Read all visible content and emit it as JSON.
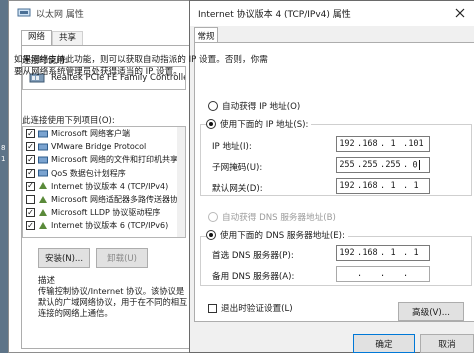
{
  "background_window": {
    "title": "以太网 属性",
    "tabs": [
      "网络",
      "共享"
    ],
    "connect_using_label": "连接时使用:",
    "adapter_name": "Realtek PCIe FE Family Controller",
    "components_label": "此连接使用下列项目(O):",
    "components": [
      {
        "label": "Microsoft 网络客户端",
        "checked": true
      },
      {
        "label": "VMware Bridge Protocol",
        "checked": true
      },
      {
        "label": "Microsoft 网络的文件和打印机共享",
        "checked": true
      },
      {
        "label": "QoS 数据包计划程序",
        "checked": true
      },
      {
        "label": "Internet 协议版本 4 (TCP/IPv4)",
        "checked": true
      },
      {
        "label": "Microsoft 网络适配器多路传送器协议",
        "checked": false
      },
      {
        "label": "Microsoft LLDP 协议驱动程序",
        "checked": true
      },
      {
        "label": "Internet 协议版本 6 (TCP/IPv6)",
        "checked": true
      }
    ],
    "install_button": "安装(N)...",
    "uninstall_button": "卸载(U)",
    "description_title": "描述",
    "description_text": "传输控制协议/Internet 协议。该协议是默认的广域网络协议，用于在不同的相互连接的网络上通信。",
    "left_strip_text": [
      "8",
      "1"
    ]
  },
  "dialog": {
    "title": "Internet 协议版本 4 (TCP/IPv4) 属性",
    "tab_general": "常规",
    "intro_text": "如果网络支持此功能，则可以获取自动指派的 IP 设置。否则，你需要从网络系统管理员处获得适当的 IP 设置。",
    "auto_ip_label": "自动获得 IP 地址(O)",
    "manual_ip_label": "使用下面的 IP 地址(S):",
    "ip_label": "IP 地址(I):",
    "subnet_label": "子网掩码(U):",
    "gateway_label": "默认网关(D):",
    "ip_octets": [
      "192",
      "168",
      "1",
      "101"
    ],
    "subnet_octets": [
      "255",
      "255",
      "255",
      "0"
    ],
    "gateway_octets": [
      "192",
      "168",
      "1",
      "1"
    ],
    "auto_dns_label": "自动获得 DNS 服务器地址(B)",
    "manual_dns_label": "使用下面的 DNS 服务器地址(E):",
    "preferred_dns_label": "首选 DNS 服务器(P):",
    "alternate_dns_label": "备用 DNS 服务器(A):",
    "preferred_dns_octets": [
      "192",
      "168",
      "1",
      "1"
    ],
    "alternate_dns_octets": [
      "",
      "",
      "",
      ""
    ],
    "validate_label": "退出时验证设置(L)",
    "advanced_button": "高级(V)...",
    "ok_button": "确定",
    "cancel_button": "取消"
  },
  "icons": {
    "title_icon": "network-adapter-icon",
    "close": "close-icon",
    "component": "network-component-icon"
  }
}
